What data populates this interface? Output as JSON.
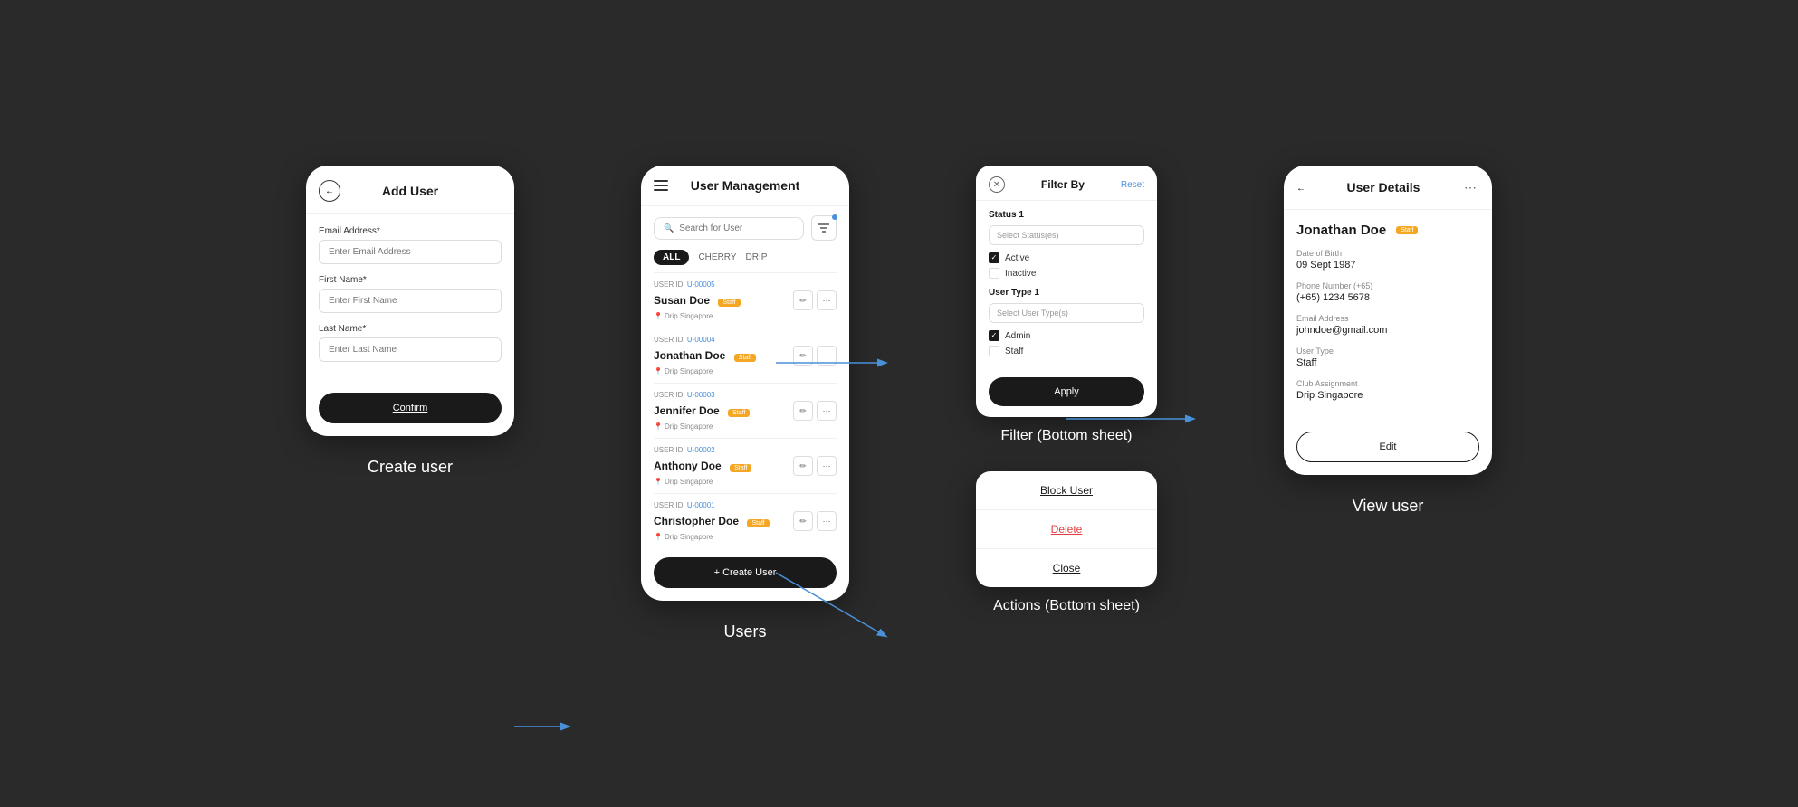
{
  "page": {
    "background": "#2a2a2a"
  },
  "createUser": {
    "title": "Add User",
    "backBtn": "←",
    "fields": [
      {
        "label": "Email Address*",
        "placeholder": "Enter Email Address"
      },
      {
        "label": "First Name*",
        "placeholder": "Enter First Name"
      },
      {
        "label": "Last Name*",
        "placeholder": "Enter Last Name"
      }
    ],
    "confirmBtn": "Confirm",
    "sectionLabel": "Create user"
  },
  "users": {
    "title": "User Management",
    "searchPlaceholder": "Search for User",
    "tabs": [
      "ALL",
      "CHERRY",
      "DRIP"
    ],
    "activeTab": "ALL",
    "users": [
      {
        "id": "U-00005",
        "name": "Susan Doe",
        "badge": "Staff",
        "location": "Drip Singapore"
      },
      {
        "id": "U-00004",
        "name": "Jonathan Doe",
        "badge": "Staff",
        "location": "Drip Singapore"
      },
      {
        "id": "U-00003",
        "name": "Jennifer Doe",
        "badge": "Staff",
        "location": "Drip Singapore"
      },
      {
        "id": "U-00002",
        "name": "Anthony Doe",
        "badge": "Staff",
        "location": "Drip Singapore"
      },
      {
        "id": "U-00001",
        "name": "Christopher Doe",
        "badge": "Staff",
        "location": "Drip Singapore"
      }
    ],
    "createBtn": "+ Create User",
    "sectionLabel": "Users"
  },
  "filterSheet": {
    "title": "Filter By",
    "resetLabel": "Reset",
    "statusSection": {
      "title": "Status  1",
      "placeholder": "Select Status(es)",
      "options": [
        {
          "label": "Active",
          "checked": true
        },
        {
          "label": "Inactive",
          "checked": false
        }
      ]
    },
    "userTypeSection": {
      "title": "User Type  1",
      "placeholder": "Select User Type(s)",
      "options": [
        {
          "label": "Admin",
          "checked": true
        },
        {
          "label": "Staff",
          "checked": false
        }
      ]
    },
    "applyBtn": "Apply",
    "sectionLabel": "Filter (Bottom sheet)"
  },
  "actionsSheet": {
    "actions": [
      {
        "label": "Block User",
        "type": "block"
      },
      {
        "label": "Delete",
        "type": "delete"
      },
      {
        "label": "Close",
        "type": "close"
      }
    ],
    "sectionLabel": "Actions (Bottom sheet)"
  },
  "userDetails": {
    "title": "User Details",
    "backBtn": "←",
    "name": "Jonathan Doe",
    "badge": "Staff",
    "fields": [
      {
        "label": "Date of Birth",
        "value": "09 Sept 1987"
      },
      {
        "label": "Phone Number (+65)",
        "value": "(+65) 1234 5678"
      },
      {
        "label": "Email Address",
        "value": "johndoe@gmail.com"
      },
      {
        "label": "User Type",
        "value": "Staff"
      },
      {
        "label": "Club Assignment",
        "value": "Drip Singapore"
      }
    ],
    "editBtn": "Edit",
    "sectionLabel": "View user"
  }
}
